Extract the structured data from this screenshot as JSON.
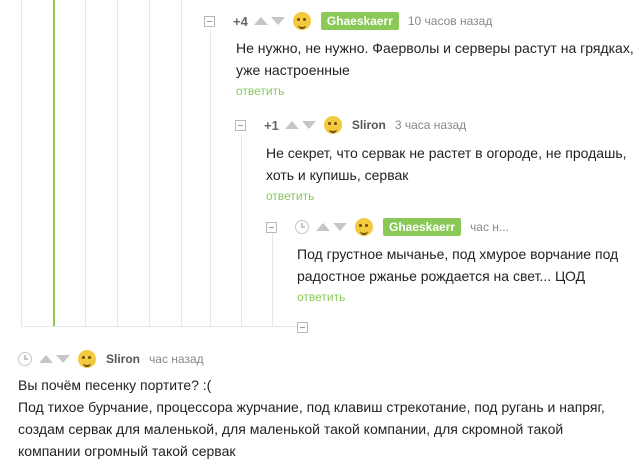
{
  "comments": [
    {
      "rating": "+4",
      "username": "Ghaeskaerr",
      "time": "10 часов назад",
      "text": [
        "Не нужно, не нужно. Фаерволы и серверы растут на грядках,",
        "уже настроенные"
      ],
      "reply": "ответить"
    },
    {
      "rating": "+1",
      "username": "Sliron",
      "time": "3 часа назад",
      "text": [
        "Не секрет, что сервак не растет в огороде, не продашь,",
        "хоть и купишь, сервак"
      ],
      "reply": "ответить"
    },
    {
      "username": "Ghaeskaerr",
      "time": "час н...",
      "text": [
        "Под грустное мычанье, под хмурое ворчание под",
        "радостное ржанье рождается на свет... ЦОД"
      ],
      "reply": "ответить"
    },
    {
      "username": "Sliron",
      "time": "час назад",
      "text": [
        "Вы почём песенку портите? :(",
        "Под тихое бурчание, процессора журчание, под клавиш стрекотание, под ругань и напряг,",
        "создам сервак для маленькой, для маленькой такой компании, для скромной такой",
        "компании огромный такой сервак"
      ]
    }
  ],
  "colors": {
    "accent": "#8ac858",
    "muted": "#888888",
    "text": "#222222"
  },
  "icons": [
    "collapse-icon",
    "upvote-icon",
    "downvote-icon",
    "clock-icon",
    "avatar-icon"
  ]
}
